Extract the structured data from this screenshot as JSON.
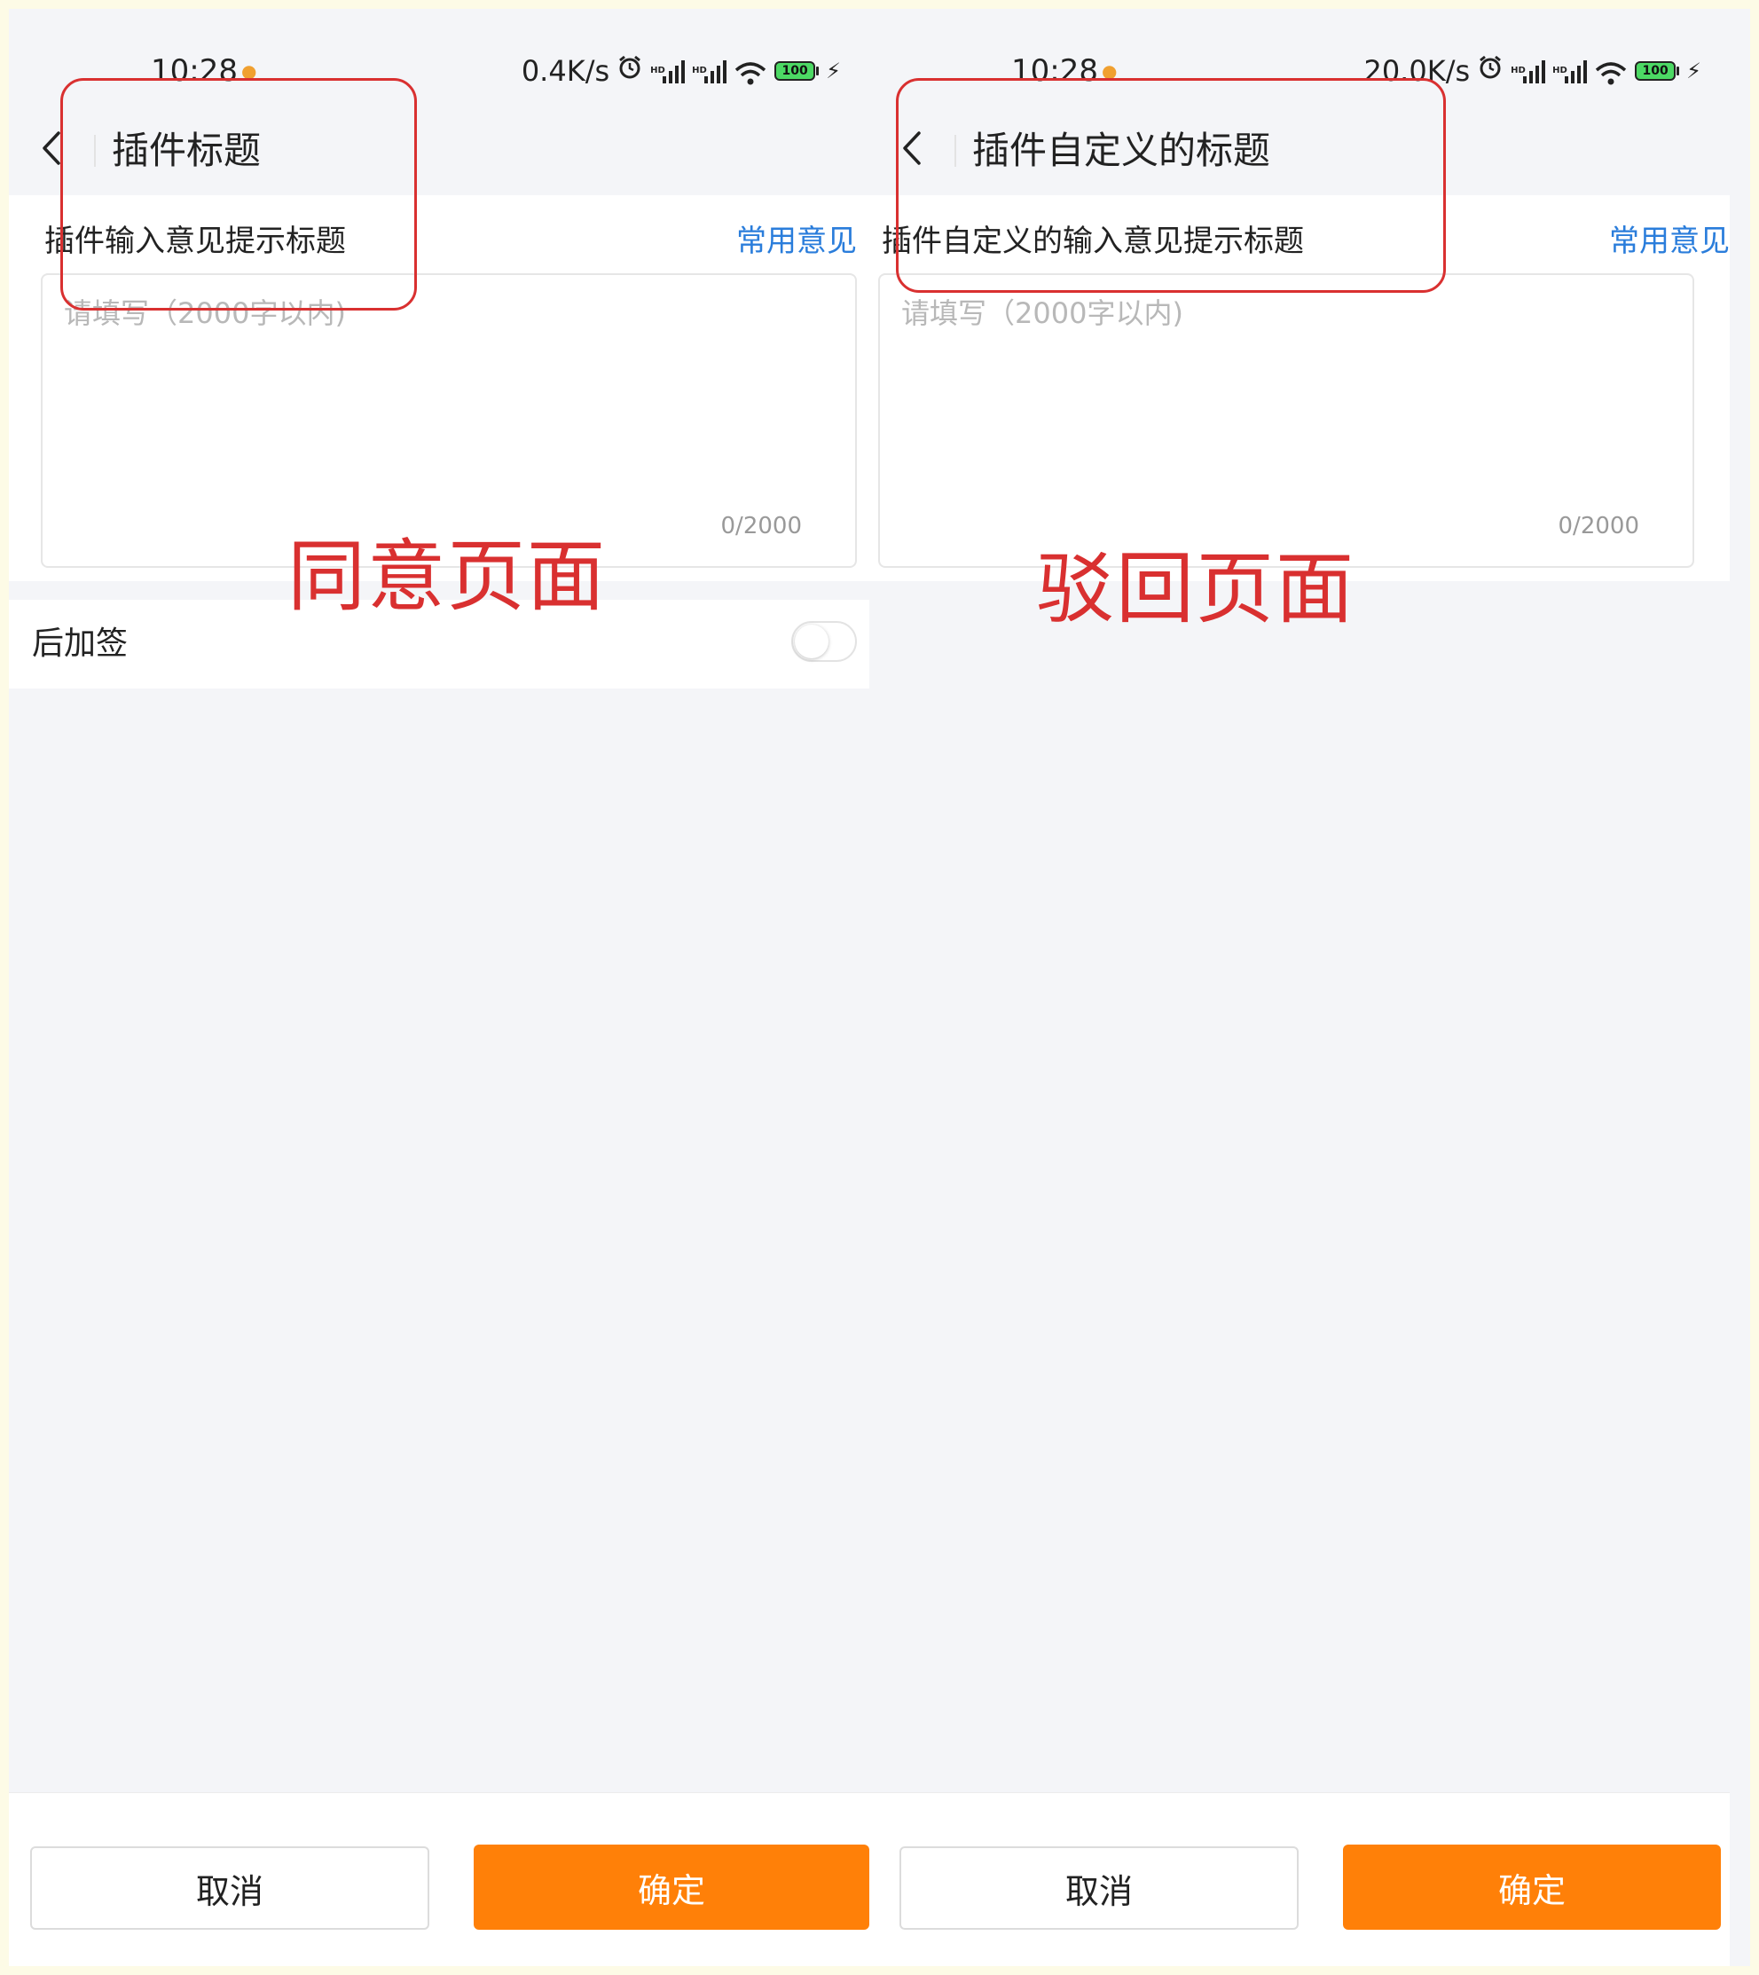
{
  "left_page": {
    "status": {
      "time": "10:28",
      "speed": "0.4K/s",
      "battery": "100"
    },
    "nav": {
      "title": "插件标题"
    },
    "opinion": {
      "label": "插件输入意见提示标题",
      "common_link": "常用意见",
      "placeholder": "请填写（2000字以内)",
      "counter": "0/2000"
    },
    "countersign": {
      "label": "后加签",
      "enabled": false
    },
    "buttons": {
      "cancel": "取消",
      "confirm": "确定"
    },
    "annotation": "同意页面"
  },
  "right_page": {
    "status": {
      "time": "10:28",
      "speed": "20.0K/s",
      "battery": "100"
    },
    "nav": {
      "title": "插件自定义的标题"
    },
    "opinion": {
      "label": "插件自定义的输入意见提示标题",
      "common_link": "常用意见",
      "placeholder": "请填写（2000字以内)",
      "counter": "0/2000"
    },
    "buttons": {
      "cancel": "取消",
      "confirm": "确定"
    },
    "annotation": "驳回页面"
  },
  "colors": {
    "accent_orange": "#ff8008",
    "link_blue": "#2a7ddb",
    "annotation_red": "#d93030",
    "page_background": "#f4f5f8"
  },
  "icons": {
    "back": "chevron-left-icon",
    "alarm": "alarm-clock-icon",
    "signal": "signal-bars-icon",
    "wifi": "wifi-icon",
    "battery": "battery-icon",
    "charging": "bolt-icon"
  }
}
